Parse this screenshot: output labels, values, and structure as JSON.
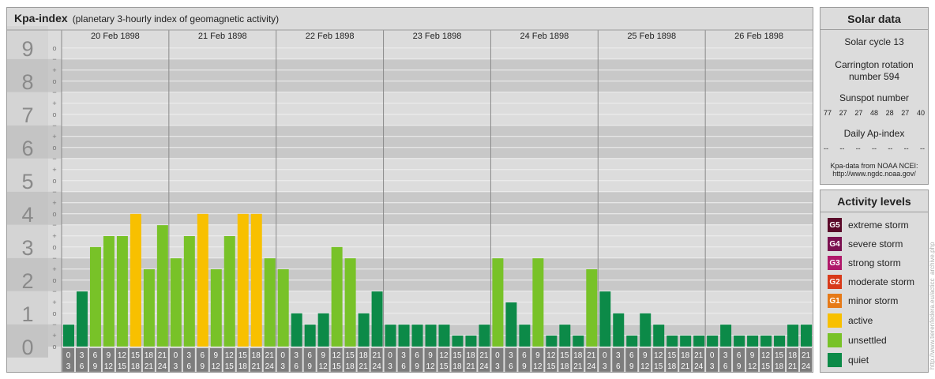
{
  "header": {
    "title": "Kpa-index",
    "subtitle": "(planetary 3-hourly index of geomagnetic activity)"
  },
  "solar": {
    "heading": "Solar data",
    "cycle": "Solar cycle 13",
    "carrington_1": "Carrington rotation",
    "carrington_2": "number 594",
    "sunspot_label": "Sunspot number",
    "sunspots": [
      "77",
      "27",
      "27",
      "48",
      "28",
      "27",
      "40"
    ],
    "ap_label": "Daily Ap-index",
    "ap_values": [
      "--",
      "--",
      "--",
      "--",
      "--",
      "--",
      "--"
    ],
    "source_1": "Kpa-data from NOAA NCEI:",
    "source_2": "http://www.ngdc.noaa.gov/"
  },
  "levels": {
    "heading": "Activity levels",
    "items": [
      {
        "badge": "G5",
        "label": "extreme storm",
        "color": "#5a0a2a"
      },
      {
        "badge": "G4",
        "label": "severe storm",
        "color": "#7a1050"
      },
      {
        "badge": "G3",
        "label": "strong storm",
        "color": "#b0186a"
      },
      {
        "badge": "G2",
        "label": "moderate storm",
        "color": "#d83a1a"
      },
      {
        "badge": "G1",
        "label": "minor storm",
        "color": "#e67a18"
      },
      {
        "badge": "",
        "label": "active",
        "color": "#f8c000"
      },
      {
        "badge": "",
        "label": "unsettled",
        "color": "#78c228"
      },
      {
        "badge": "",
        "label": "quiet",
        "color": "#0c8a48"
      }
    ]
  },
  "credit": "http://www.tierenfedera.eu/acticc_archive.php",
  "chart_data": {
    "type": "bar",
    "title": "Kpa-index",
    "days": [
      "20 Feb 1898",
      "21 Feb 1898",
      "22 Feb 1898",
      "23 Feb 1898",
      "24 Feb 1898",
      "25 Feb 1898",
      "26 Feb 1898"
    ],
    "interval_labels": [
      [
        "0",
        "3"
      ],
      [
        "3",
        "6"
      ],
      [
        "6",
        "9"
      ],
      [
        "9",
        "12"
      ],
      [
        "12",
        "15"
      ],
      [
        "15",
        "18"
      ],
      [
        "18",
        "21"
      ],
      [
        "21",
        "24"
      ]
    ],
    "y_ticks": [
      "0",
      "1",
      "2",
      "3",
      "4",
      "5",
      "6",
      "7",
      "8",
      "9"
    ],
    "sub_ticks": [
      "+",
      "−",
      "o"
    ],
    "ylim": [
      0,
      9.33
    ],
    "values": [
      0.33,
      1.33,
      2.67,
      3.0,
      3.0,
      3.67,
      2.0,
      3.33,
      2.33,
      3.0,
      3.67,
      2.0,
      3.0,
      3.67,
      3.67,
      2.33,
      2.0,
      0.67,
      0.33,
      0.67,
      2.67,
      2.33,
      0.67,
      1.33,
      0.33,
      0.33,
      0.33,
      0.33,
      0.33,
      0.0,
      0.0,
      0.33,
      2.33,
      1.0,
      0.33,
      2.33,
      0.0,
      0.33,
      0.0,
      2.0,
      1.33,
      0.67,
      0.0,
      0.67,
      0.33,
      0.0,
      0.0,
      0.0,
      0.0,
      0.33,
      0.0,
      0.0,
      0.0,
      0.0,
      0.33,
      0.33
    ],
    "color_thresholds": {
      "quiet_below": 2.0,
      "unsettled_below": 3.67
    },
    "colors": {
      "quiet": "#0c8a48",
      "unsettled": "#78c228",
      "active": "#f8c000"
    }
  }
}
